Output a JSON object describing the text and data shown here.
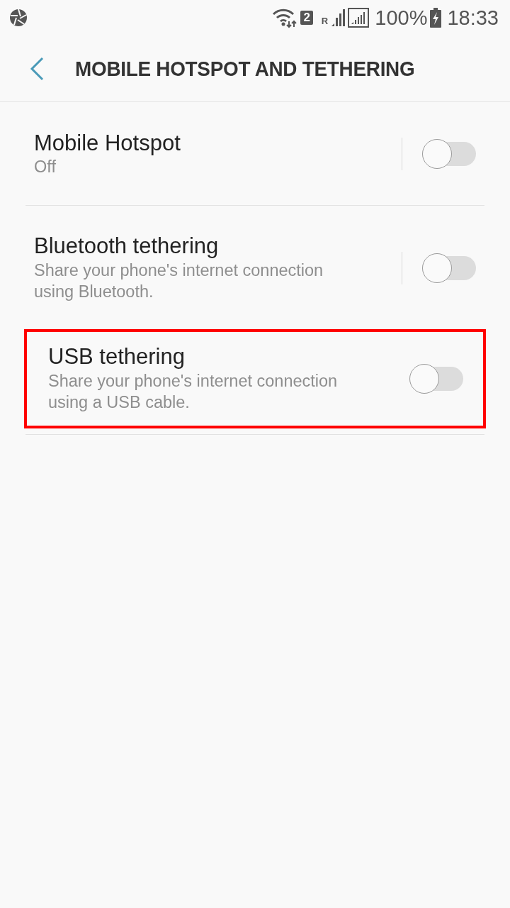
{
  "status_bar": {
    "sim_badge": "2",
    "roaming": "R",
    "battery": "100%",
    "time": "18:33"
  },
  "header": {
    "title": "MOBILE HOTSPOT AND TETHERING"
  },
  "settings": [
    {
      "title": "Mobile Hotspot",
      "subtitle": "Off",
      "on": false,
      "has_divider": true,
      "highlighted": false
    },
    {
      "title": "Bluetooth tethering",
      "subtitle": "Share your phone's internet connection using Bluetooth.",
      "on": false,
      "has_divider": true,
      "highlighted": false
    },
    {
      "title": "USB tethering",
      "subtitle": "Share your phone's internet connection using a USB cable.",
      "on": false,
      "has_divider": false,
      "highlighted": true
    }
  ]
}
